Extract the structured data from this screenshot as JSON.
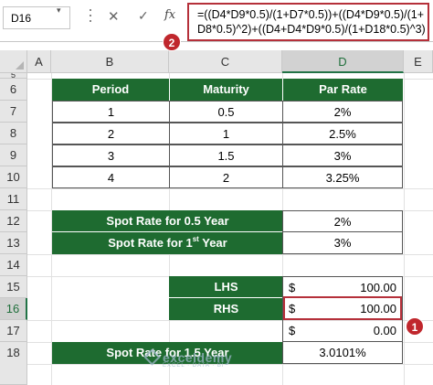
{
  "formula_bar": {
    "name_box": "D16",
    "name_box_arrow": "▾",
    "cancel_icon": "✕",
    "enter_icon": "✓",
    "fx_label": "fx",
    "formula_line1": "=((D4*D9*0.5)/(1+D7*0.5))+((D4*D9*0.5)/(1+",
    "formula_line2": "D8*0.5)^2)+((D4+D4*D9*0.5)/(1+D18*0.5)^3)"
  },
  "columns": [
    "A",
    "B",
    "C",
    "D",
    "E"
  ],
  "rows": [
    "5",
    "6",
    "7",
    "8",
    "9",
    "10",
    "11",
    "12",
    "13",
    "14",
    "15",
    "16",
    "17",
    "18"
  ],
  "maturity_table": {
    "headers": [
      "Period",
      "Maturity",
      "Par Rate"
    ],
    "rows": [
      [
        "1",
        "0.5",
        "2%"
      ],
      [
        "2",
        "1",
        "2.5%"
      ],
      [
        "3",
        "1.5",
        "3%"
      ],
      [
        "4",
        "2",
        "3.25%"
      ]
    ]
  },
  "spot_rates": {
    "row12_label": "Spot Rate for 0.5 Year",
    "row12_value": "2%",
    "row13_label_prefix": "Spot Rate for 1",
    "row13_label_sup": "st",
    "row13_label_suffix": " Year",
    "row13_value": "3%"
  },
  "equation_check": {
    "lhs_label": "LHS",
    "lhs_currency": "$",
    "lhs_value": "100.00",
    "rhs_label": "RHS",
    "rhs_currency": "$",
    "rhs_value": "100.00",
    "diff_currency": "$",
    "diff_value": "0.00"
  },
  "result": {
    "label": "Spot Rate for 1.5 Year",
    "value": "3.0101%"
  },
  "callouts": {
    "badge1": "1",
    "badge2": "2"
  },
  "watermark": {
    "name": "exceldemy",
    "tagline": "EXCEL · DATA · BI"
  },
  "colors": {
    "header_green": "#1e6b30",
    "highlight_red": "#b5303a",
    "badge_red": "#c0272d",
    "excel_green": "#217346"
  }
}
